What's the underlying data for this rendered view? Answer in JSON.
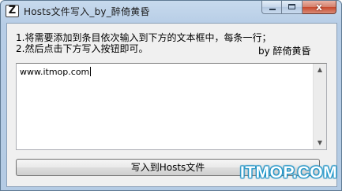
{
  "window": {
    "icon_letter": "Z",
    "title": "Hosts文件写入_by_醉倚黄昏",
    "controls": {
      "close_glyph": "x"
    }
  },
  "instructions": {
    "line1": "1.将需要添加到条目依次输入到下方的文本框中，每条一行；",
    "line2": "2.然后点击下方写入按钮即可。",
    "author": "by 醉倚黄昏"
  },
  "editor": {
    "value": "www.itmop.com"
  },
  "actions": {
    "write_button_label": "写入到Hosts文件"
  },
  "watermark": {
    "text": "ITMOP.COM"
  }
}
